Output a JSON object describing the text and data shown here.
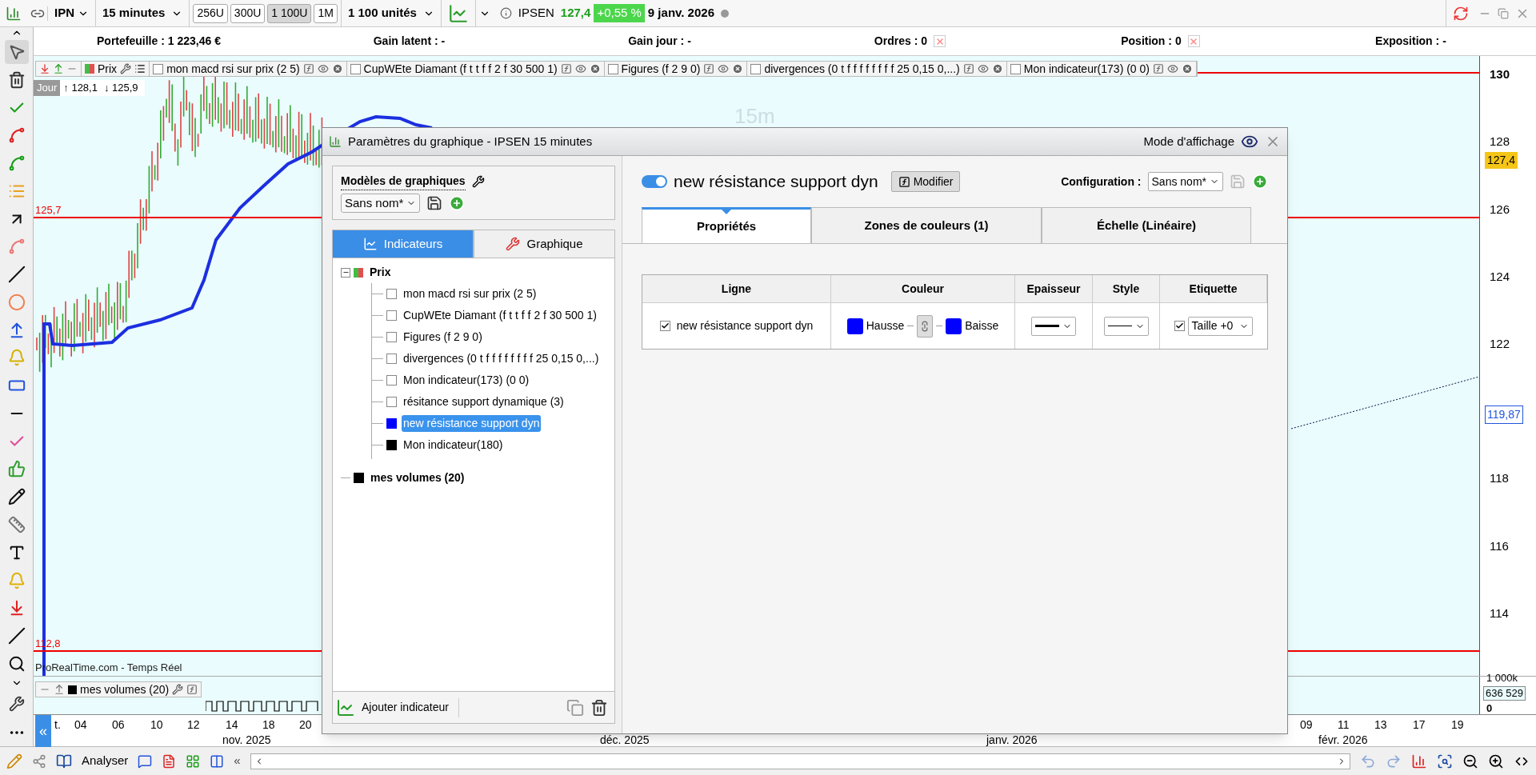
{
  "toolbar": {
    "symbol": "IPN",
    "timeframe": "15 minutes",
    "unit_buttons": [
      {
        "label": "256U",
        "selected": false
      },
      {
        "label": "300U",
        "selected": false
      },
      {
        "label": "1 100U",
        "selected": true
      },
      {
        "label": "1M",
        "selected": false
      }
    ],
    "units": "1 100 unités",
    "instrument": "IPSEN",
    "price": "127,4",
    "change": "+0,55 %",
    "date": "9 janv. 2026"
  },
  "stats": [
    {
      "label": "Portefeuille :",
      "value": "1 223,46 €",
      "cancel": false
    },
    {
      "label": "Gain latent :",
      "value": "-",
      "cancel": false
    },
    {
      "label": "Gain jour :",
      "value": "-",
      "cancel": false
    },
    {
      "label": "Ordres :",
      "value": "0",
      "cancel": true
    },
    {
      "label": "Position :",
      "value": "0",
      "cancel": true
    },
    {
      "label": "Exposition :",
      "value": "-",
      "cancel": false
    }
  ],
  "indicator_bar": {
    "price_label": "Prix",
    "indicators": [
      {
        "label": "mon macd rsi sur prix (2 5)",
        "checked": false
      },
      {
        "label": "CupWEte Diamant (f t t f f 2 f 30 500 1)",
        "checked": false
      },
      {
        "label": "Figures (f 2 9 0)",
        "checked": false
      },
      {
        "label": "divergences (0 t f f f f f f f f 25 0,15 0,...)",
        "checked": false
      },
      {
        "label": "Mon indicateur(173) (0 0)",
        "checked": false
      }
    ]
  },
  "chart": {
    "period_badge": "Jour",
    "high": "↑ 128,1",
    "low": "↓ 125,9",
    "interval_label": "15m",
    "levels": [
      {
        "label": "125,7"
      },
      {
        "label": "112,8"
      }
    ],
    "source": "ProRealTime.com - Temps Réel",
    "volume_label": "mes volumes (20)"
  },
  "price_axis": {
    "ticks": [
      "130",
      "128",
      "126",
      "124",
      "122",
      "118",
      "116",
      "114"
    ],
    "current_price": "127,4",
    "marker": "119,87",
    "volume_tick": "1 000k",
    "volume_value": "636 529",
    "volume_zero": "0"
  },
  "date_axis": {
    "collapse": "«",
    "days": [
      "t.",
      "04",
      "06",
      "10",
      "12",
      "14",
      "18",
      "20",
      "09",
      "11",
      "13",
      "17",
      "19"
    ],
    "months": [
      "nov. 2025",
      "déc. 2025",
      "janv. 2026",
      "févr. 2026"
    ]
  },
  "bottom_bar": {
    "analyze_label": "Analyser",
    "collapse": "«"
  },
  "dialog": {
    "title": "Paramètres du graphique - IPSEN 15 minutes",
    "display_mode": "Mode d'affichage",
    "models": {
      "title": "Modèles de graphiques",
      "value": "Sans nom*"
    },
    "tabs": [
      {
        "label": "Indicateurs",
        "selected": true
      },
      {
        "label": "Graphique",
        "selected": false
      }
    ],
    "tree": [
      {
        "label": "Prix",
        "kind": "price",
        "expanded": true,
        "selected": false,
        "children": [
          {
            "label": "mon macd rsi sur prix (2 5)",
            "kind": "checkbox",
            "checked": false,
            "selected": false
          },
          {
            "label": "CupWEte Diamant (f t t f f 2 f 30 500 1)",
            "kind": "checkbox",
            "checked": false,
            "selected": false
          },
          {
            "label": "Figures (f 2 9 0)",
            "kind": "checkbox",
            "checked": false,
            "selected": false
          },
          {
            "label": "divergences (0 t f f f f f f f f 25 0,15 0,...)",
            "kind": "checkbox",
            "checked": false,
            "selected": false
          },
          {
            "label": "Mon indicateur(173) (0 0)",
            "kind": "checkbox",
            "checked": false,
            "selected": false
          },
          {
            "label": "résitance support dynamique (3)",
            "kind": "checkbox",
            "checked": false,
            "selected": false
          },
          {
            "label": "new résistance support dyn",
            "kind": "color",
            "color": "#0000ff",
            "selected": true
          },
          {
            "label": "Mon indicateur(180)",
            "kind": "color",
            "color": "#000000",
            "selected": false
          }
        ]
      },
      {
        "label": "mes volumes (20)",
        "kind": "color",
        "color": "#000000",
        "selected": false
      }
    ],
    "add_label": "Ajouter indicateur",
    "editor": {
      "enabled": true,
      "name": "new résistance support dyn",
      "modify_label": "Modifier",
      "config_label": "Configuration :",
      "config_value": "Sans nom*",
      "tabs": [
        {
          "label": "Propriétés",
          "selected": true
        },
        {
          "label": "Zones de couleurs (1)",
          "selected": false
        },
        {
          "label": "Échelle (Linéaire)",
          "selected": false
        }
      ],
      "columns": [
        "Ligne",
        "Couleur",
        "Epaisseur",
        "Style",
        "Etiquette"
      ],
      "rows": [
        {
          "checked": true,
          "name": "new résistance support dyn",
          "colors": [
            {
              "label": "Hausse",
              "color": "#0000ff"
            },
            {
              "label": "Baisse",
              "color": "#0000ff"
            }
          ],
          "label_checked": true,
          "size": "Taille +0"
        }
      ]
    }
  }
}
